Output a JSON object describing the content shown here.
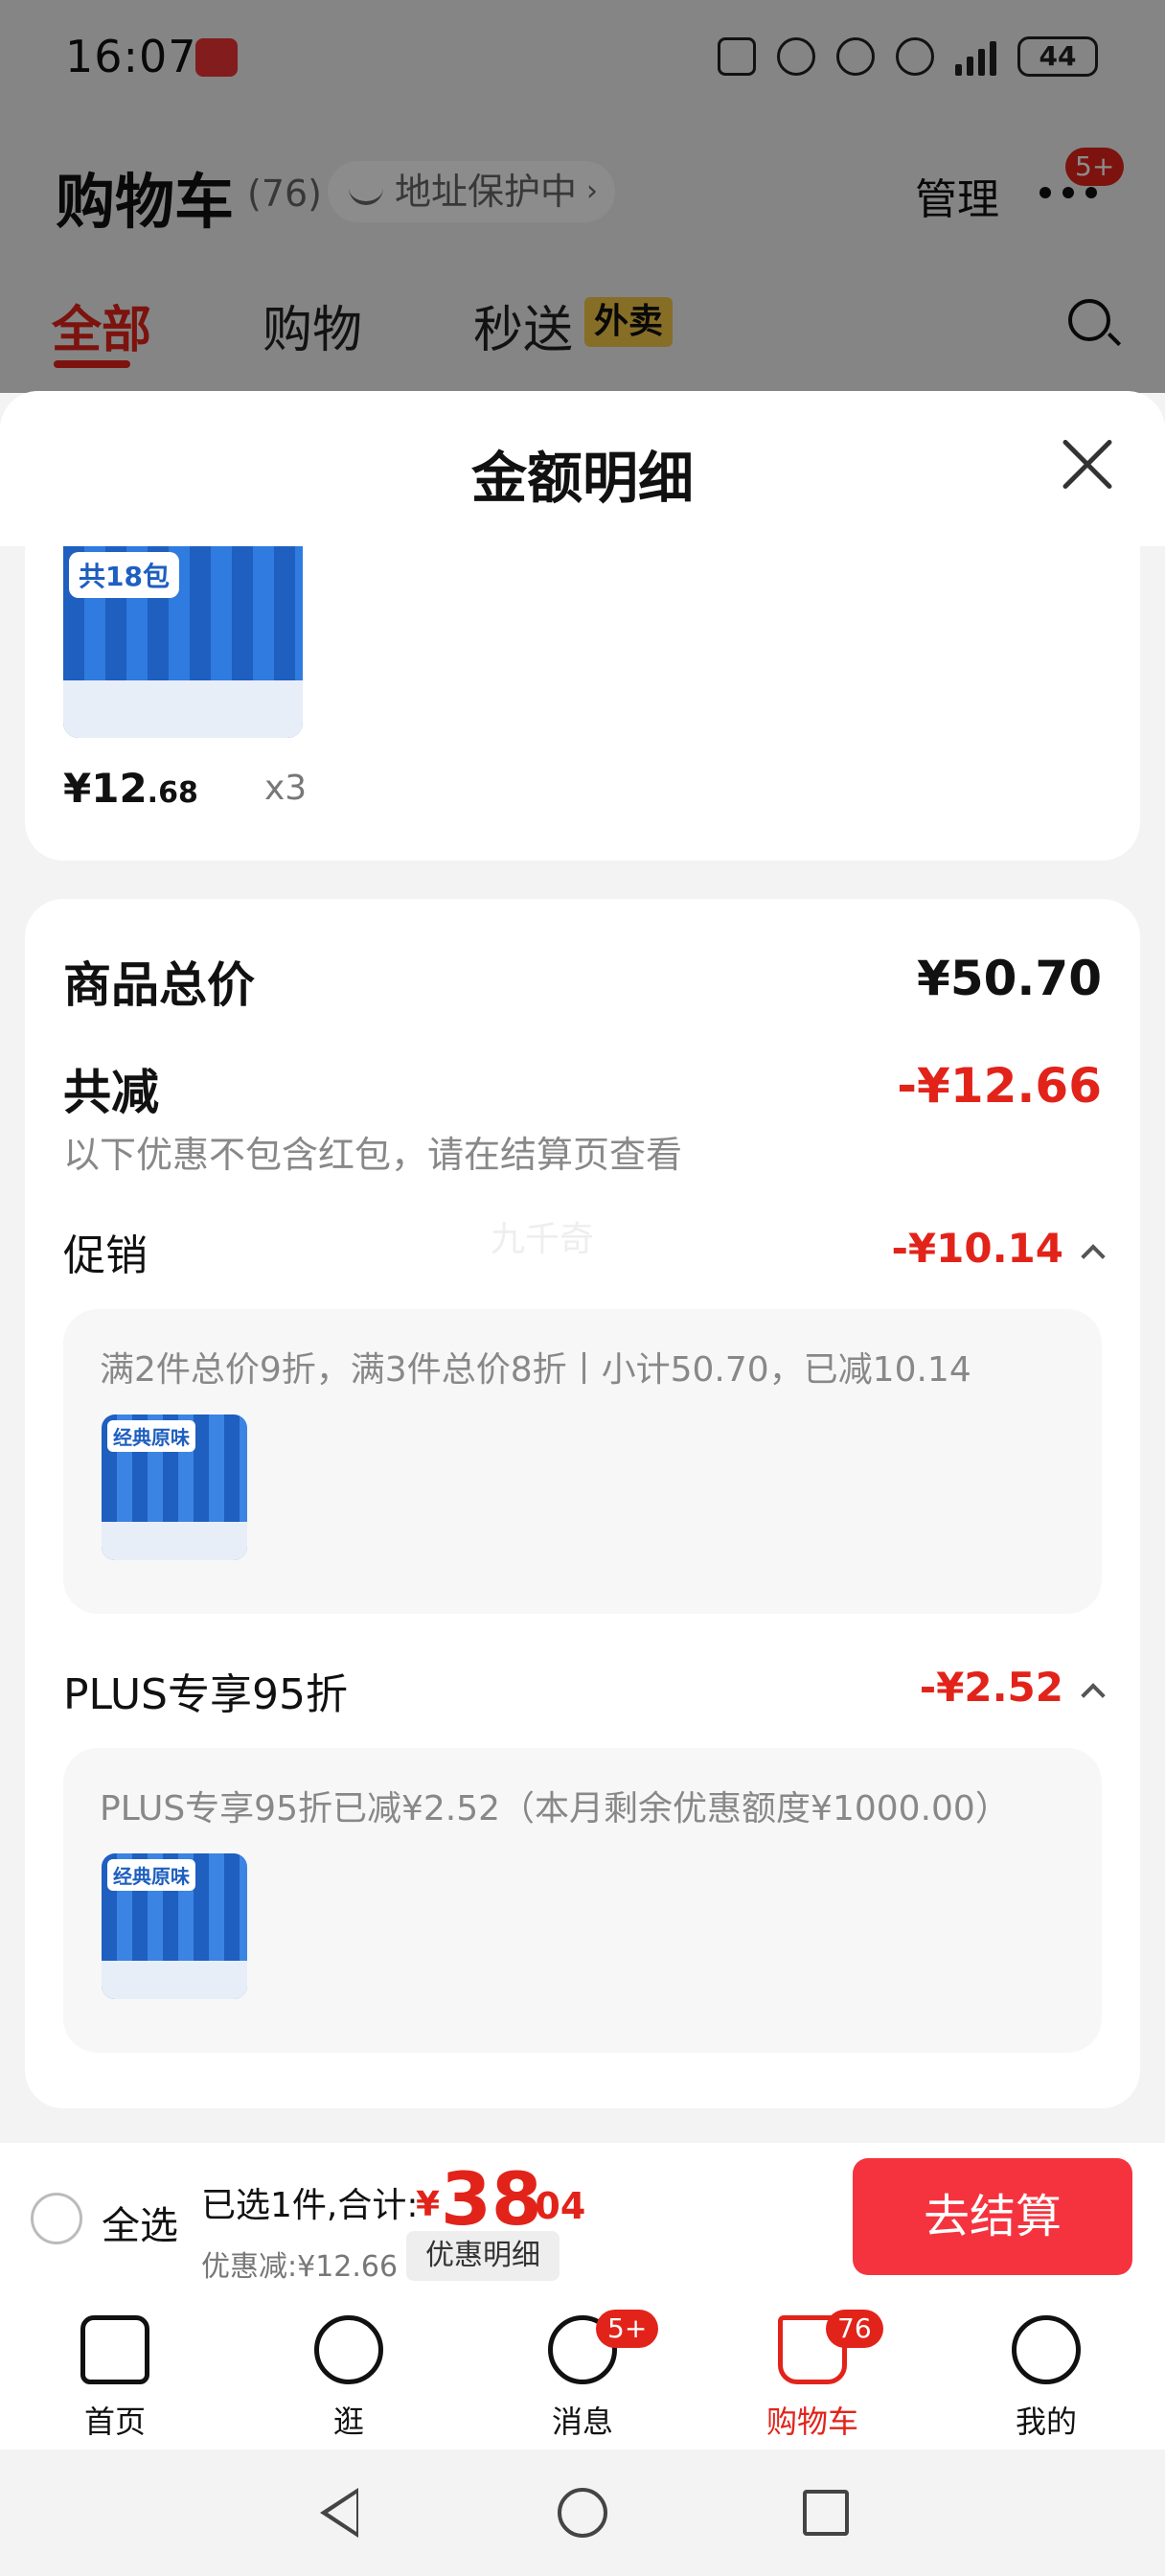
{
  "status_bar": {
    "time": "16:07",
    "battery": "44"
  },
  "header": {
    "title": "购物车",
    "count": "(76)",
    "address_protect": "地址保护中",
    "manage": "管理",
    "more_badge": "5+"
  },
  "tabs": [
    {
      "label": "全部",
      "active": true
    },
    {
      "label": "购物",
      "active": false
    },
    {
      "label": "秒送",
      "active": false,
      "badge": "外卖"
    }
  ],
  "sheet": {
    "title": "金额明细",
    "product": {
      "image_tag": "共18包",
      "price_main": "¥12",
      "price_decimal": ".68",
      "quantity": "x3"
    },
    "total_label": "商品总价",
    "total_value": "¥50.70",
    "reduce_label": "共减",
    "reduce_value": "-¥12.66",
    "reduce_note": "以下优惠不包含红包，请在结算页查看",
    "watermark": "九千奇",
    "promotions": [
      {
        "label": "促销",
        "value": "-¥10.14",
        "description": "满2件总价9折，满3件总价8折丨小计50.70，已减10.14",
        "thumb_tag": "经典原味"
      },
      {
        "label": "PLUS专享95折",
        "value": "-¥2.52",
        "description": "PLUS专享95折已减¥2.52（本月剩余优惠额度¥1000.00）",
        "thumb_tag": "经典原味"
      }
    ]
  },
  "checkout": {
    "select_all": "全选",
    "selected_info": "已选1件,合计:",
    "total_yen": "¥",
    "total_int": "38",
    "total_dec": ".04",
    "discount_line": "优惠减:¥12.66",
    "detail_chip": "优惠明细",
    "button": "去结算"
  },
  "tabbar": [
    {
      "label": "首页",
      "icon": "home-icon"
    },
    {
      "label": "逛",
      "icon": "browse-icon"
    },
    {
      "label": "消息",
      "icon": "message-icon",
      "badge": "5+"
    },
    {
      "label": "购物车",
      "icon": "cart-icon",
      "badge": "76",
      "active": true
    },
    {
      "label": "我的",
      "icon": "profile-icon"
    }
  ],
  "colors": {
    "accent_red": "#e2231a",
    "checkout_button": "#f5333f",
    "oreo_blue": "#1e5fc0"
  }
}
